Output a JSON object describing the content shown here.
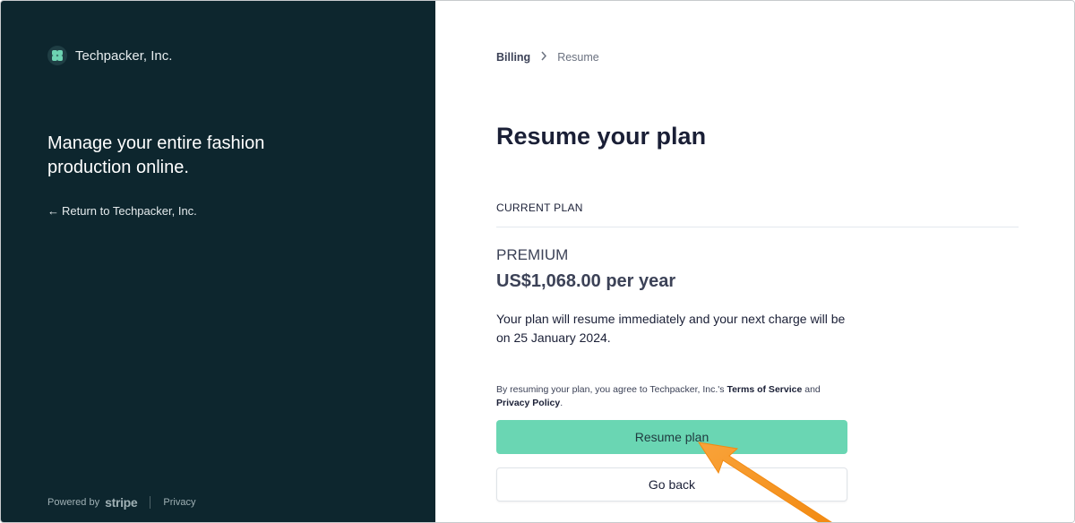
{
  "brand": {
    "name": "Techpacker, Inc.",
    "icon": "techpacker-logo-icon"
  },
  "left_panel": {
    "tagline": "Manage your entire fashion production online.",
    "return_link": "Return to Techpacker, Inc.",
    "return_arrow": "←",
    "footer": {
      "powered_by": "Powered by",
      "stripe": "stripe",
      "privacy": "Privacy"
    }
  },
  "breadcrumb": {
    "billing": "Billing",
    "separator": "›",
    "current": "Resume"
  },
  "page": {
    "title": "Resume your plan",
    "section_label": "CURRENT PLAN",
    "plan_name": "PREMIUM",
    "plan_price": "US$1,068.00 per year",
    "description": "Your plan will resume immediately and your next charge will be on 25 January 2024.",
    "legal": {
      "prefix": "By resuming your plan, you agree to Techpacker, Inc.'s ",
      "terms": "Terms of Service",
      "middle": " and ",
      "privacy": "Privacy Policy",
      "suffix": "."
    },
    "primary_button": "Resume plan",
    "secondary_button": "Go back"
  },
  "colors": {
    "left_bg": "#0d262e",
    "accent": "#6ad6b3",
    "annotation_arrow": "#f7931e"
  }
}
